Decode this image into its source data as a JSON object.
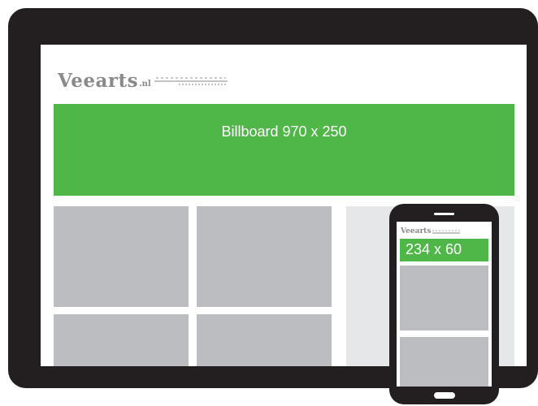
{
  "tablet": {
    "logo": {
      "word": "Veearts",
      "suffix": ".nl"
    },
    "billboard_label": "Billboard 970 x 250"
  },
  "phone": {
    "logo_word": "Veearts",
    "banner_label": "234 x 60"
  },
  "colors": {
    "device_frame": "#231f20",
    "ad_green": "#4fb748",
    "content_gray": "#bcbdc0",
    "sidebar_gray": "#e6e7e8"
  }
}
